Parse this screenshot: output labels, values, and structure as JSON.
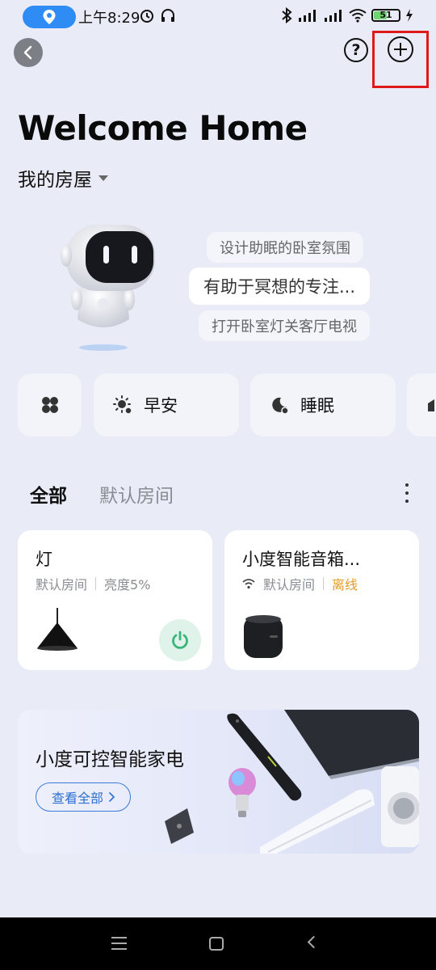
{
  "status_bar": {
    "time": "上午8:29",
    "battery": "51",
    "icons": [
      "location-icon",
      "alarm-icon",
      "headphone-icon",
      "bluetooth-icon",
      "signal-icon",
      "wifi-icon",
      "battery-icon",
      "charging-icon"
    ]
  },
  "header": {
    "title": "Welcome Home",
    "house_selector": "我的房屋"
  },
  "assistant": {
    "suggestions": [
      "设计助眠的卧室氛围",
      "有助于冥想的专注...",
      "打开卧室灯关客厅电视"
    ]
  },
  "scenes": [
    {
      "icon": "grid-icon",
      "label": ""
    },
    {
      "icon": "sun-icon",
      "label": "早安"
    },
    {
      "icon": "moon-icon",
      "label": "睡眠"
    }
  ],
  "tabs": {
    "all": "全部",
    "default_room": "默认房间"
  },
  "devices": [
    {
      "name": "灯",
      "room": "默认房间",
      "status": "亮度5%",
      "icon": "lamp-icon"
    },
    {
      "name": "小度智能音箱...",
      "room": "默认房间",
      "status": "离线",
      "icon": "speaker-icon"
    }
  ],
  "banner": {
    "title": "小度可控智能家电",
    "button": "查看全部"
  },
  "colors": {
    "background": "#e9ebf6",
    "offline": "#e39b25",
    "link": "#2d6fd0",
    "highlight": "#e01a1a",
    "power": "#3bb57c"
  }
}
